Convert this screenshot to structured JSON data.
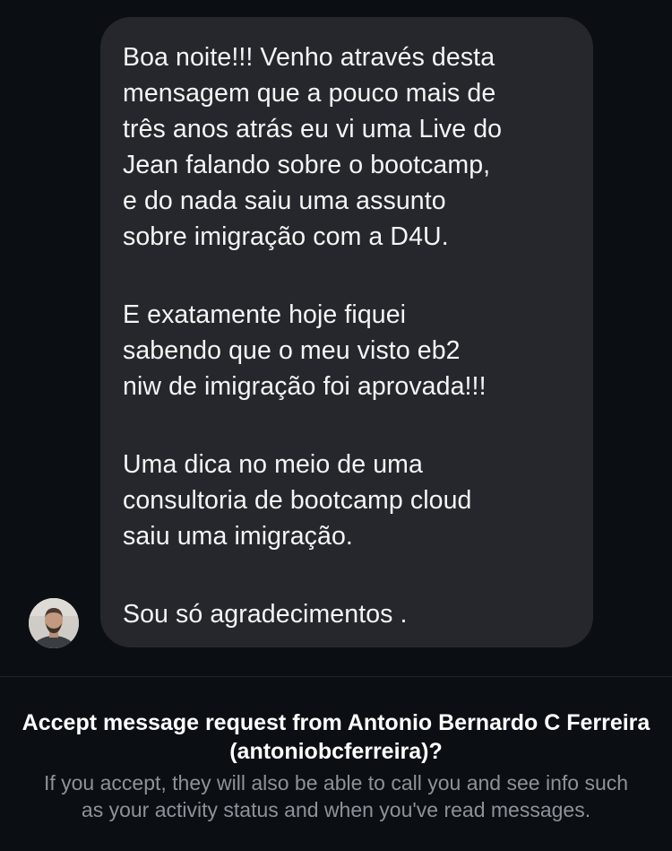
{
  "message": {
    "paragraphs": [
      "Boa noite!!! Venho através desta\nmensagem  que a pouco mais de\ntrês anos atrás eu vi uma Live do\nJean falando sobre o bootcamp,\ne do nada saiu uma assunto\nsobre imigração com a D4U.",
      "E exatamente hoje fiquei\nsabendo que o meu visto eb2\nniw de imigração foi aprovada!!!",
      "Uma dica no meio de uma\nconsultoria de bootcamp cloud\nsaiu uma imigração.",
      "Sou só agradecimentos ."
    ]
  },
  "request": {
    "title": "Accept message request from Antonio Bernardo C Ferreira (antoniobcferreira)?",
    "info": "If you accept, they will also be able to call you and see info such as your activity status and when you've read messages."
  },
  "colors": {
    "background": "#0b0e13",
    "bubble": "#25272d",
    "secondary_text": "#8e9299"
  }
}
